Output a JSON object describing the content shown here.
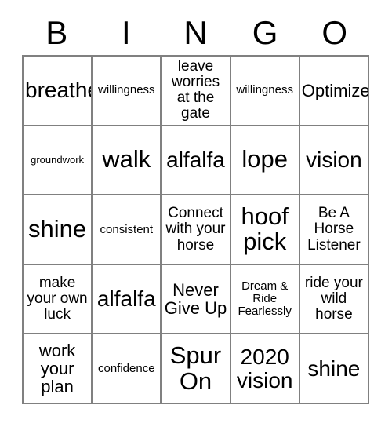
{
  "card": {
    "header_letters": [
      "B",
      "I",
      "N",
      "G",
      "O"
    ],
    "rows": [
      [
        {
          "text": "breathe",
          "size": "lg"
        },
        {
          "text": "willingness",
          "size": "xs"
        },
        {
          "text": "leave worries at the gate",
          "size": "sm"
        },
        {
          "text": "willingness",
          "size": "xs"
        },
        {
          "text": "Optimize",
          "size": "md"
        }
      ],
      [
        {
          "text": "groundwork",
          "size": "xxs"
        },
        {
          "text": "walk",
          "size": "xl"
        },
        {
          "text": "alfalfa",
          "size": "lg"
        },
        {
          "text": "lope",
          "size": "xl"
        },
        {
          "text": "vision",
          "size": "lg"
        }
      ],
      [
        {
          "text": "shine",
          "size": "xl"
        },
        {
          "text": "consistent",
          "size": "xs"
        },
        {
          "text": "Connect with your horse",
          "size": "sm"
        },
        {
          "text": "hoof pick",
          "size": "xl"
        },
        {
          "text": "Be A Horse Listener",
          "size": "sm"
        }
      ],
      [
        {
          "text": "make your own luck",
          "size": "sm"
        },
        {
          "text": "alfalfa",
          "size": "lg"
        },
        {
          "text": "Never Give Up",
          "size": "md"
        },
        {
          "text": "Dream & Ride Fearlessly",
          "size": "xs"
        },
        {
          "text": "ride your wild horse",
          "size": "sm"
        }
      ],
      [
        {
          "text": "work your plan",
          "size": "md"
        },
        {
          "text": "confidence",
          "size": "xs"
        },
        {
          "text": "Spur On",
          "size": "xl"
        },
        {
          "text": "2020 vision",
          "size": "lg"
        },
        {
          "text": "shine",
          "size": "lg"
        }
      ]
    ]
  },
  "colors": {
    "grid_line": "#808080",
    "text": "#000000",
    "background": "#ffffff"
  }
}
